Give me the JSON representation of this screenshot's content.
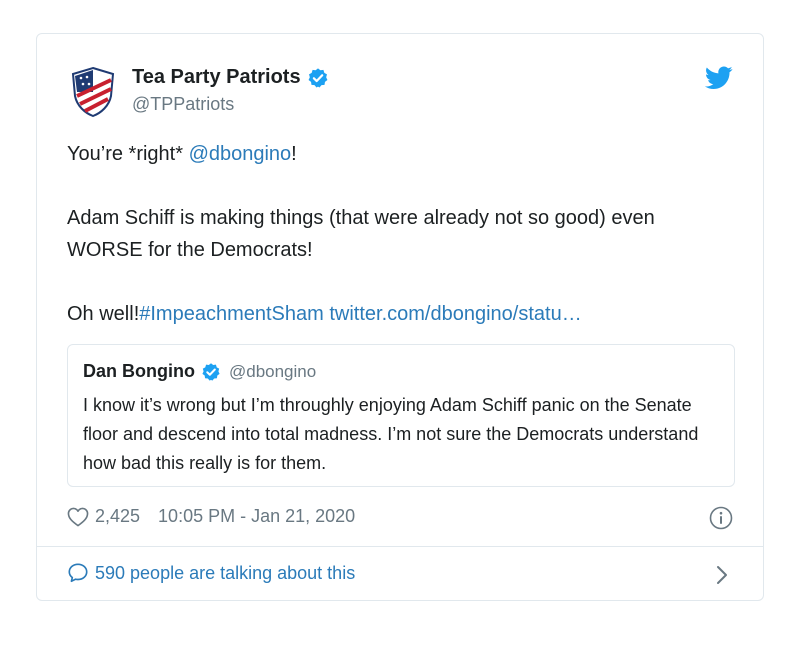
{
  "author": {
    "display_name": "Tea Party Patriots",
    "handle": "@TPPatriots"
  },
  "tweet": {
    "line1_prefix": "You’re *right* ",
    "line1_mention": "@dbongino",
    "line1_suffix": "!",
    "paragraph2": "Adam Schiff is making things (that were already not so good) even WORSE for the Democrats!",
    "line3_prefix": "Oh well!",
    "hashtag": "#ImpeachmentSham",
    "link": " twitter.com/dbongino/statu…"
  },
  "quoted_tweet": {
    "display_name": "Dan Bongino",
    "handle": "@dbongino",
    "text": "I know it’s wrong but I’m throughly enjoying Adam Schiff panic on the Senate floor and descend into total madness. I’m not sure the Democrats understand how bad this really is for them."
  },
  "meta": {
    "likes": "2,425",
    "timestamp": "10:05 PM - Jan 21, 2020"
  },
  "footer": {
    "conversation": "590 people are talking about this"
  },
  "icons": {
    "avatar": "shield-logo",
    "verified": "verified-badge-icon",
    "brand": "twitter-bird-icon",
    "like": "heart-icon",
    "info": "info-icon",
    "reply": "speech-bubble-icon",
    "more": "chevron-right-icon"
  },
  "colors": {
    "link": "#2b7bb9",
    "verified": "#1da1f2",
    "muted": "#697882",
    "border": "#e1e8ed"
  }
}
